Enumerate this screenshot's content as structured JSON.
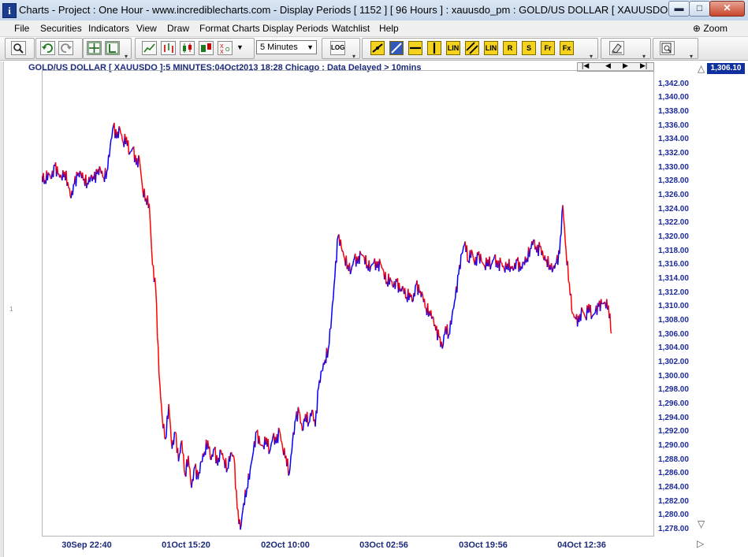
{
  "window": {
    "title": "Charts - Project : One Hour - www.incrediblecharts.com - Display Periods  [ 1152 ]  [ 96 Hours ] : xauusdo_pm : GOLD/US DOLLAR  [ XAUUSDO ]",
    "minimize_glyph": "▬",
    "maximize_glyph": "□",
    "close_glyph": "✕"
  },
  "menu": {
    "items": [
      "File",
      "Securities",
      "Indicators",
      "View",
      "Draw",
      "Format Charts",
      "Display Periods",
      "Watchlist",
      "Help"
    ],
    "zoom_label": "Zoom"
  },
  "toolbar": {
    "period_value": "5 Minutes",
    "log_label": "LOG",
    "yellow_buttons": [
      "LIN",
      "LIN",
      "R",
      "S",
      "Fr",
      "Fx"
    ]
  },
  "chart": {
    "header": "GOLD/US DOLLAR [ XAUUSDO ]:5 MINUTES:04Oct2013 18:28 Chicago : Data Delayed > 10mins",
    "last_price": "1,306.10",
    "rail_mark": "1",
    "up_colour": "#0000ff",
    "down_colour": "#ff0000"
  },
  "chart_data": {
    "type": "line",
    "title": "GOLD/US DOLLAR [ XAUUSDO ]:5 MINUTES:04Oct2013 18:28 Chicago : Data Delayed > 10mins",
    "ylim": [
      1277,
      1344
    ],
    "yticks": [
      "1,342.00",
      "1,340.00",
      "1,338.00",
      "1,336.00",
      "1,334.00",
      "1,332.00",
      "1,330.00",
      "1,328.00",
      "1,326.00",
      "1,324.00",
      "1,322.00",
      "1,320.00",
      "1,318.00",
      "1,316.00",
      "1,314.00",
      "1,312.00",
      "1,310.00",
      "1,308.00",
      "1,306.00",
      "1,304.00",
      "1,302.00",
      "1,300.00",
      "1,298.00",
      "1,296.00",
      "1,294.00",
      "1,292.00",
      "1,290.00",
      "1,288.00",
      "1,286.00",
      "1,284.00",
      "1,282.00",
      "1,280.00",
      "1,278.00"
    ],
    "xticks": [
      "30Sep 22:40",
      "01Oct 15:20",
      "02Oct 10:00",
      "03Oct 02:56",
      "03Oct 19:56",
      "04Oct 12:36"
    ],
    "series": [
      {
        "values": [
          1328.8,
          1328.2,
          1329.3,
          1328.4,
          1330.2,
          1329.0,
          1328.6,
          1329.4,
          1327.9,
          1325.6,
          1327.6,
          1328.8,
          1329.2,
          1328.4,
          1327.8,
          1328.6,
          1328.3,
          1329.1,
          1329.8,
          1328.6,
          1329.5,
          1333.0,
          1336.0,
          1334.2,
          1335.6,
          1333.6,
          1334.4,
          1332.0,
          1332.8,
          1330.4,
          1331.2,
          1326.8,
          1325.6,
          1324.8,
          1316.0,
          1312.6,
          1300.4,
          1294.0,
          1291.0,
          1296.0,
          1289.6,
          1292.0,
          1287.8,
          1290.8,
          1285.8,
          1288.6,
          1284.0,
          1287.0,
          1285.2,
          1287.8,
          1289.2,
          1290.8,
          1288.0,
          1289.6,
          1287.2,
          1289.4,
          1288.0,
          1286.8,
          1289.0,
          1288.4,
          1281.0,
          1278.0,
          1281.8,
          1284.0,
          1286.6,
          1289.2,
          1292.0,
          1290.2,
          1290.0,
          1291.2,
          1289.2,
          1291.4,
          1290.4,
          1292.2,
          1289.6,
          1288.6,
          1286.0,
          1290.6,
          1293.8,
          1295.0,
          1292.2,
          1294.6,
          1293.4,
          1295.2,
          1292.8,
          1298.4,
          1300.8,
          1302.4,
          1304.0,
          1308.6,
          1314.2,
          1320.2,
          1318.6,
          1317.0,
          1316.0,
          1315.2,
          1317.0,
          1316.2,
          1317.6,
          1317.2,
          1316.0,
          1315.8,
          1316.4,
          1315.6,
          1316.2,
          1315.0,
          1313.6,
          1314.2,
          1312.8,
          1313.6,
          1312.2,
          1312.8,
          1311.4,
          1312.0,
          1310.8,
          1313.2,
          1312.0,
          1311.6,
          1309.8,
          1309.4,
          1308.6,
          1306.6,
          1305.6,
          1304.0,
          1307.2,
          1306.0,
          1308.8,
          1311.2,
          1314.6,
          1317.6,
          1319.4,
          1316.6,
          1318.2,
          1316.0,
          1317.4,
          1316.6,
          1315.8,
          1316.8,
          1316.0,
          1317.2,
          1315.6,
          1316.4,
          1315.4,
          1316.2,
          1315.8,
          1315.4,
          1316.6,
          1315.2,
          1316.4,
          1317.0,
          1318.4,
          1319.6,
          1317.8,
          1318.6,
          1317.2,
          1316.8,
          1316.0,
          1315.4,
          1316.2,
          1317.6,
          1324.6,
          1318.0,
          1313.4,
          1309.0,
          1308.2,
          1307.8,
          1309.6,
          1308.4,
          1310.4,
          1308.6,
          1309.2,
          1310.0,
          1310.4,
          1310.6,
          1310.2,
          1306.2
        ]
      }
    ]
  }
}
